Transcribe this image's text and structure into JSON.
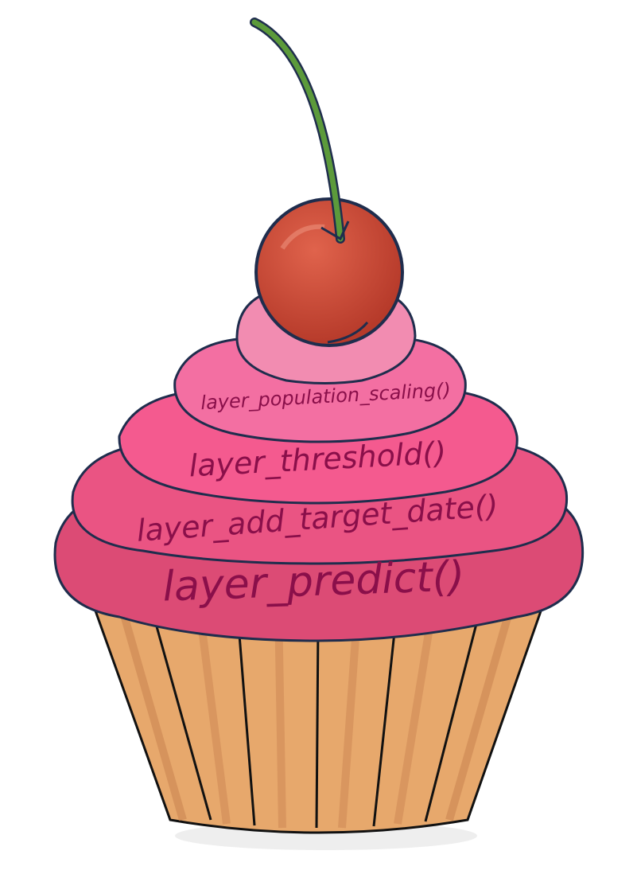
{
  "layers": [
    {
      "label": "layer_population_scaling()",
      "color": "#f36fa2"
    },
    {
      "label": "layer_threshold()",
      "color": "#f45a8f"
    },
    {
      "label": "layer_add_target_date()",
      "color": "#ea5483"
    },
    {
      "label": "layer_predict()",
      "color": "#dc4b75"
    }
  ],
  "colors": {
    "outline": "#1f2d4d",
    "label_text": "#8a0f4a",
    "cherry": "#c94431",
    "stem": "#5c9a3b",
    "wrapper": "#e7a86c",
    "wrapper_dark": "#d08a52",
    "top_swirl": "#f28cb1"
  }
}
